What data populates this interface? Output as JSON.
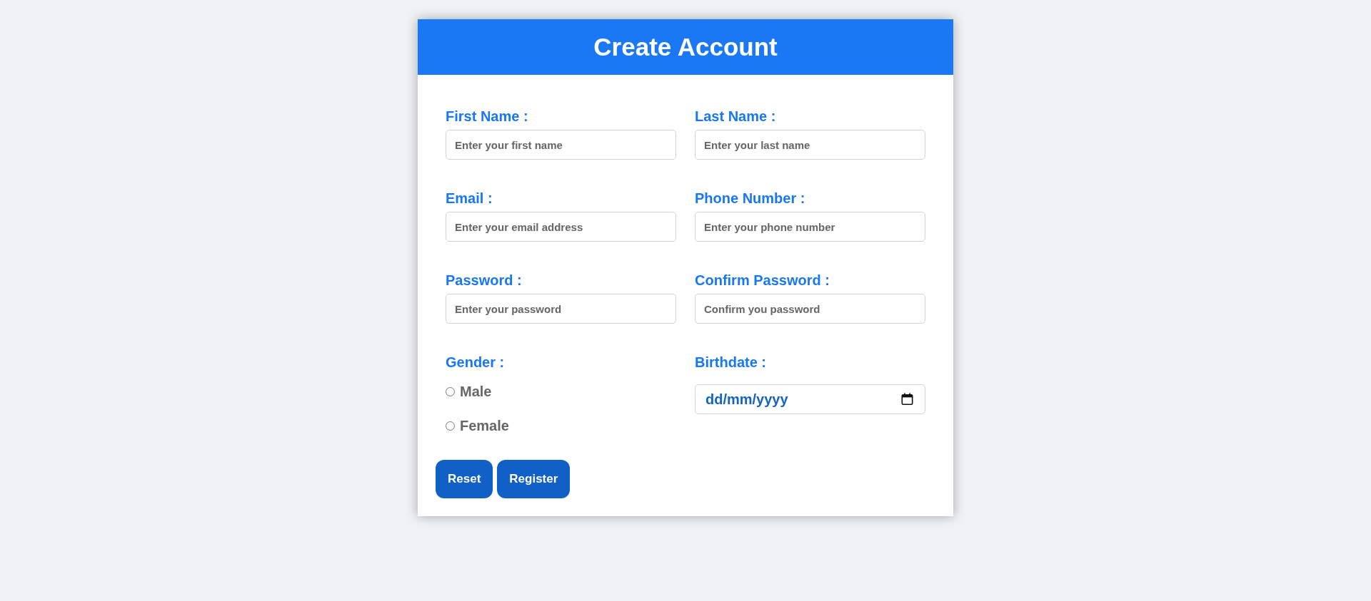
{
  "header": {
    "title": "Create Account"
  },
  "fields": [
    {
      "kind": "text",
      "label": "First Name :",
      "placeholder": "Enter your first name"
    },
    {
      "kind": "text",
      "label": "Last Name :",
      "placeholder": "Enter your last name"
    },
    {
      "kind": "text",
      "label": "Email :",
      "placeholder": "Enter your email address"
    },
    {
      "kind": "text",
      "label": "Phone Number :",
      "placeholder": "Enter your phone number"
    },
    {
      "kind": "text",
      "label": "Password :",
      "placeholder": "Enter your password"
    },
    {
      "kind": "text",
      "label": "Confirm Password :",
      "placeholder": "Confirm you password"
    },
    {
      "kind": "radio",
      "label": "Gender :",
      "options": [
        {
          "label": "Male",
          "selected": false
        },
        {
          "label": "Female",
          "selected": false
        }
      ]
    },
    {
      "kind": "date",
      "label": "Birthdate :",
      "placeholder": "dd/mm/yyyy"
    }
  ],
  "buttons": [
    "Reset",
    "Register"
  ]
}
